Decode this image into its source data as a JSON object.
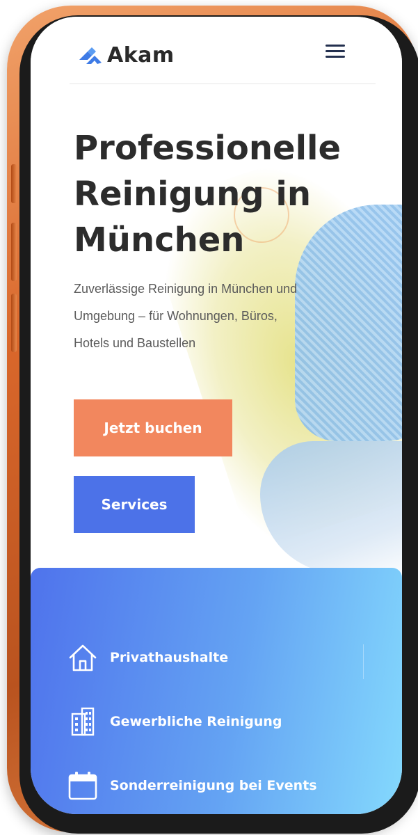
{
  "brand": {
    "name": "Akam",
    "logo_icon": "chevron-up-logo-icon",
    "accent_color": "#3e7be6"
  },
  "header": {
    "menu_icon": "hamburger-menu-icon"
  },
  "hero": {
    "title_lines": [
      "Professionelle",
      "Reinigung in",
      "München"
    ],
    "subtitle_lines": [
      "Zuverlässige Reinigung in München und",
      "Umgebung – für Wohnungen, Büros,",
      "Hotels und Baustellen"
    ],
    "primary_button": {
      "label": "Jetzt buchen",
      "color": "#f2875e"
    },
    "secondary_button": {
      "label": "Services",
      "color": "#4c72e8"
    }
  },
  "services": {
    "gradient_colors": [
      "#4f73ec",
      "#84d9fd"
    ],
    "items": [
      {
        "label": "Privathaushalte",
        "icon": "house-icon"
      },
      {
        "label": "Gewerbliche Reinigung",
        "icon": "office-building-icon"
      },
      {
        "label": "Sonderreinigung bei Events",
        "icon": "calendar-icon"
      }
    ]
  }
}
